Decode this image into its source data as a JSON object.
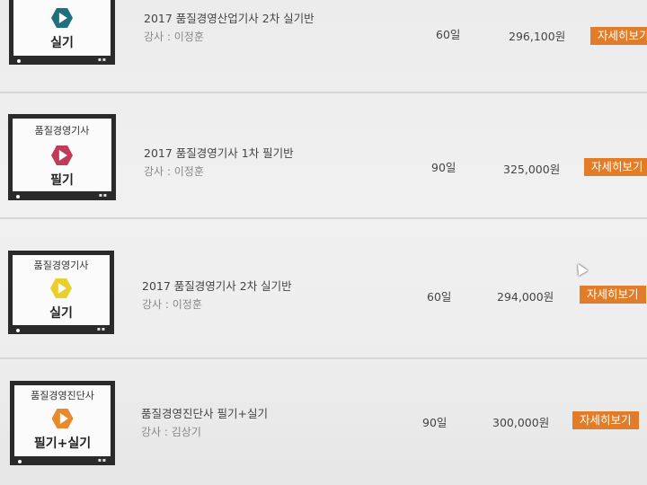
{
  "courses": [
    {
      "category": "",
      "type": "실기",
      "icon_color": "#1f6f7e",
      "title": "2017 품질경영산업기사 2차 실기반",
      "instructor": "강사 : 이정훈",
      "days": "60일",
      "price": "296,100원",
      "button": "자세히보기"
    },
    {
      "category": "품질경영기사",
      "type": "필기",
      "icon_color": "#c23a5a",
      "title": "2017 품질경영기사 1차 필기반",
      "instructor": "강사 : 이정훈",
      "days": "90일",
      "price": "325,000원",
      "button": "자세히보기"
    },
    {
      "category": "품질경영기사",
      "type": "실기",
      "icon_color": "#e8cf2a",
      "title": "2017 품질경영기사 2차 실기반",
      "instructor": "강사 : 이정훈",
      "days": "60일",
      "price": "294,000원",
      "button": "자세히보기"
    },
    {
      "category": "품질경영진단사",
      "type": "필기+실기",
      "icon_color": "#e68a2c",
      "title": "품질경영진단사 필기+실기",
      "instructor": "강사 : 김상기",
      "days": "90일",
      "price": "300,000원",
      "button": "자세히보기"
    }
  ],
  "accent_color": "#e17d28"
}
